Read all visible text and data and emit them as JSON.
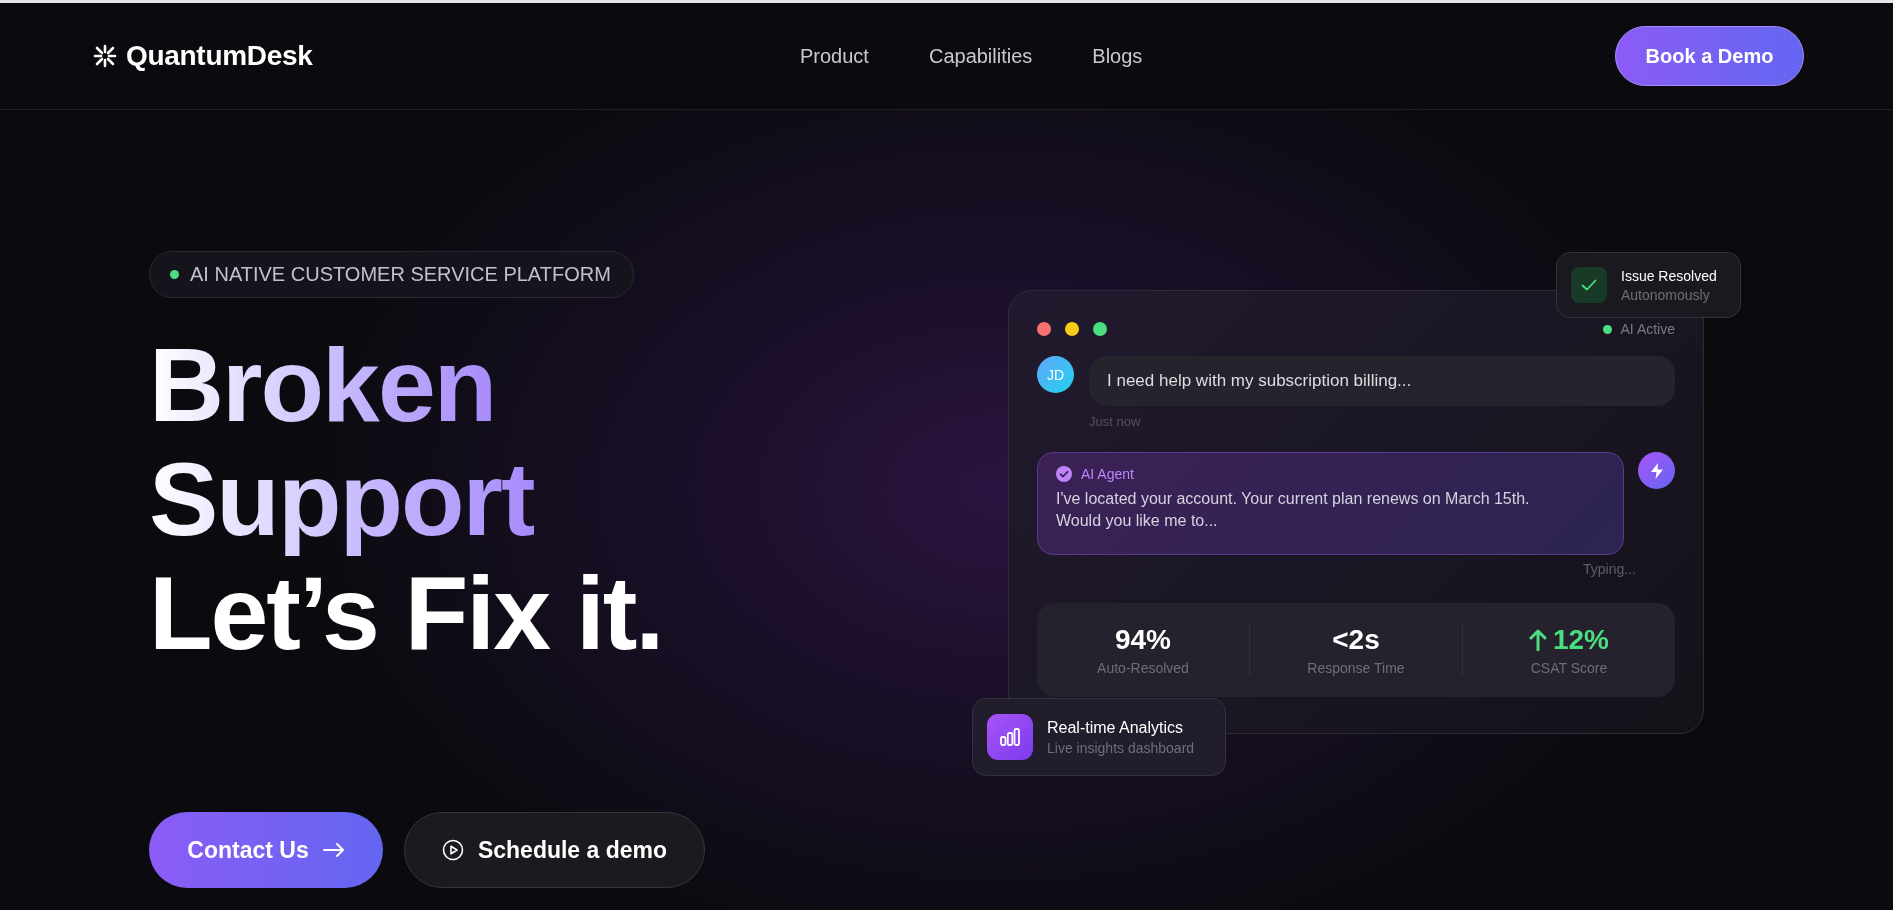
{
  "brand": {
    "name": "QuantumDesk"
  },
  "nav": [
    {
      "label": "Product"
    },
    {
      "label": "Capabilities"
    },
    {
      "label": "Blogs"
    }
  ],
  "header_button": {
    "label": "Book a Demo"
  },
  "badge": {
    "label": "AI NATIVE CUSTOMER SERVICE PLATFORM"
  },
  "headline": [
    {
      "text": "Broken",
      "gradient": true
    },
    {
      "text": "Support",
      "gradient": true
    },
    {
      "text": "Let’s Fix it.",
      "gradient": false
    }
  ],
  "actions": [
    {
      "label": "Contact Us",
      "kind": "primary"
    },
    {
      "label": "Schedule a demo",
      "kind": "secondary"
    }
  ],
  "chat_window": {
    "status": "AI Active",
    "messages": [
      {
        "kind": "user",
        "avatar": "JD",
        "text": "I need help with my subscription billing...",
        "time": "Just now"
      },
      {
        "kind": "agent",
        "sender": "AI Agent",
        "text": "I've located your account. Your current plan renews on March 15th. Would you like me to...",
        "status": "Typing..."
      }
    ],
    "stats": [
      {
        "value": "94%",
        "label": "Auto-Resolved",
        "rising": false
      },
      {
        "value": "<2s",
        "label": "Response Time",
        "rising": false
      },
      {
        "value": "12%",
        "label": "CSAT Score",
        "rising": true
      }
    ]
  },
  "floating_cards": [
    {
      "kind": "resolved",
      "title": "Issue Resolved",
      "subtitle": "Autonomously"
    },
    {
      "kind": "analytics",
      "title": "Real-time Analytics",
      "subtitle": "Live insights dashboard"
    }
  ]
}
